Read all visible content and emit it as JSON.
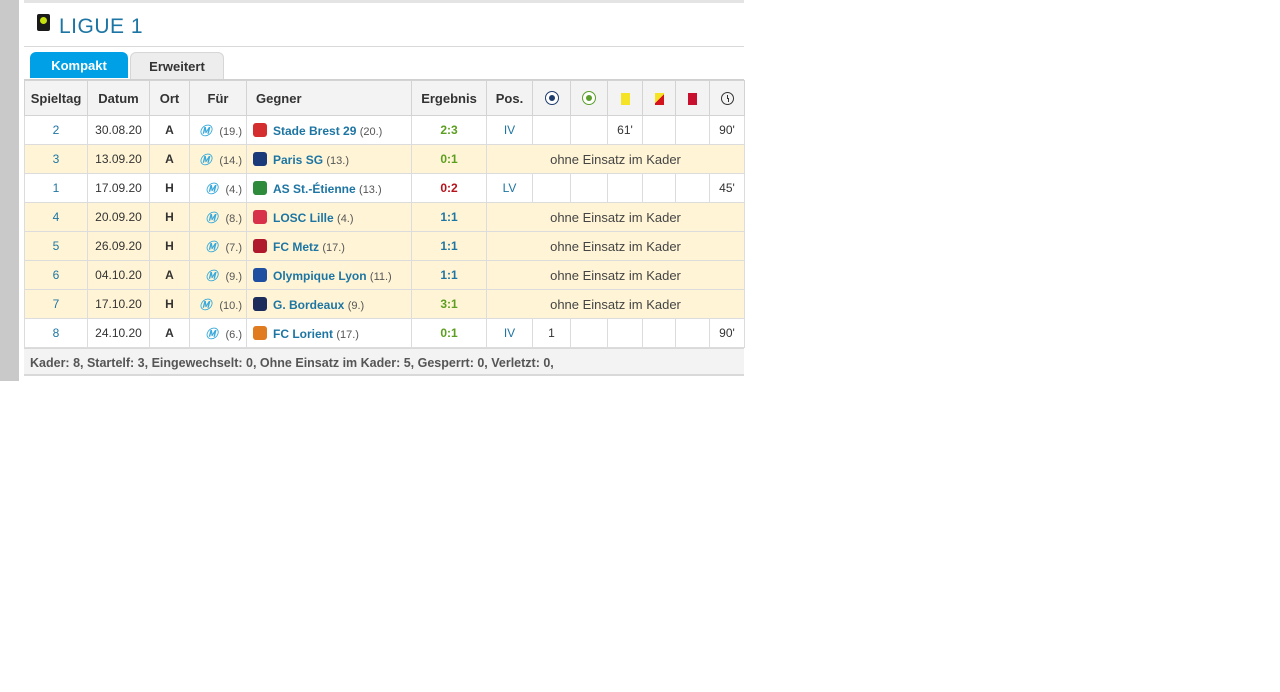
{
  "league": {
    "title": "LIGUE 1",
    "logo_icon": "ligue1-logo-icon"
  },
  "tabs": [
    {
      "label": "Kompakt",
      "active": true
    },
    {
      "label": "Erweitert",
      "active": false
    }
  ],
  "columns": {
    "spieltag": "Spieltag",
    "datum": "Datum",
    "ort": "Ort",
    "fuer": "Für",
    "gegner": "Gegner",
    "ergebnis": "Ergebnis",
    "pos": "Pos.",
    "tore_icon": "goal-ball-icon",
    "vorlagen_icon": "assist-ball-icon",
    "gelb_icon": "yellow-card-icon",
    "gelbrot_icon": "yellow-red-card-icon",
    "rot_icon": "red-card-icon",
    "minuten_icon": "clock-icon"
  },
  "rows": [
    {
      "spieltag": "2",
      "datum": "30.08.20",
      "ort": "A",
      "fuer_rank": "(19.)",
      "gegner": "Stade Brest 29",
      "gegner_rank": "(20.)",
      "ergebnis": "2:3",
      "result": "green",
      "pos": "IV",
      "tore": "",
      "vorlagen": "",
      "gelb": "61'",
      "gelbrot": "",
      "rot": "",
      "minuten": "90'",
      "played": true,
      "logo_color": "#d42e2e"
    },
    {
      "spieltag": "3",
      "datum": "13.09.20",
      "ort": "A",
      "fuer_rank": "(14.)",
      "gegner": "Paris SG",
      "gegner_rank": "(13.)",
      "ergebnis": "0:1",
      "result": "green",
      "status": "ohne Einsatz im Kader",
      "played": false,
      "logo_color": "#1b3a7a"
    },
    {
      "spieltag": "1",
      "datum": "17.09.20",
      "ort": "H",
      "fuer_rank": "(4.)",
      "gegner": "AS St.-Étienne",
      "gegner_rank": "(13.)",
      "ergebnis": "0:2",
      "result": "red",
      "pos": "LV",
      "tore": "",
      "vorlagen": "",
      "gelb": "",
      "gelbrot": "",
      "rot": "",
      "minuten": "45'",
      "played": true,
      "logo_color": "#2e8b3c"
    },
    {
      "spieltag": "4",
      "datum": "20.09.20",
      "ort": "H",
      "fuer_rank": "(8.)",
      "gegner": "LOSC Lille",
      "gegner_rank": "(4.)",
      "ergebnis": "1:1",
      "result": "blue",
      "status": "ohne Einsatz im Kader",
      "played": false,
      "logo_color": "#d8314b"
    },
    {
      "spieltag": "5",
      "datum": "26.09.20",
      "ort": "H",
      "fuer_rank": "(7.)",
      "gegner": "FC Metz",
      "gegner_rank": "(17.)",
      "ergebnis": "1:1",
      "result": "blue",
      "status": "ohne Einsatz im Kader",
      "played": false,
      "logo_color": "#b0182e"
    },
    {
      "spieltag": "6",
      "datum": "04.10.20",
      "ort": "A",
      "fuer_rank": "(9.)",
      "gegner": "Olympique Lyon",
      "gegner_rank": "(11.)",
      "ergebnis": "1:1",
      "result": "blue",
      "status": "ohne Einsatz im Kader",
      "played": false,
      "logo_color": "#1f4fa0"
    },
    {
      "spieltag": "7",
      "datum": "17.10.20",
      "ort": "H",
      "fuer_rank": "(10.)",
      "gegner": "G. Bordeaux",
      "gegner_rank": "(9.)",
      "ergebnis": "3:1",
      "result": "green",
      "status": "ohne Einsatz im Kader",
      "played": false,
      "logo_color": "#1c2c5b"
    },
    {
      "spieltag": "8",
      "datum": "24.10.20",
      "ort": "A",
      "fuer_rank": "(6.)",
      "gegner": "FC Lorient",
      "gegner_rank": "(17.)",
      "ergebnis": "0:1",
      "result": "green",
      "pos": "IV",
      "tore": "1",
      "vorlagen": "",
      "gelb": "",
      "gelbrot": "",
      "rot": "",
      "minuten": "90'",
      "played": true,
      "logo_color": "#e07b1f"
    }
  ],
  "fuer_logo_text": "Ⓜ",
  "footer": {
    "summary": "Kader: 8, Startelf: 3, Eingewechselt: 0, Ohne Einsatz im Kader: 5, Gesperrt: 0, Verletzt: 0,"
  },
  "colors": {
    "accent": "#00a0e6",
    "link": "#1d75a3",
    "highlight_row": "#fff5d6"
  }
}
